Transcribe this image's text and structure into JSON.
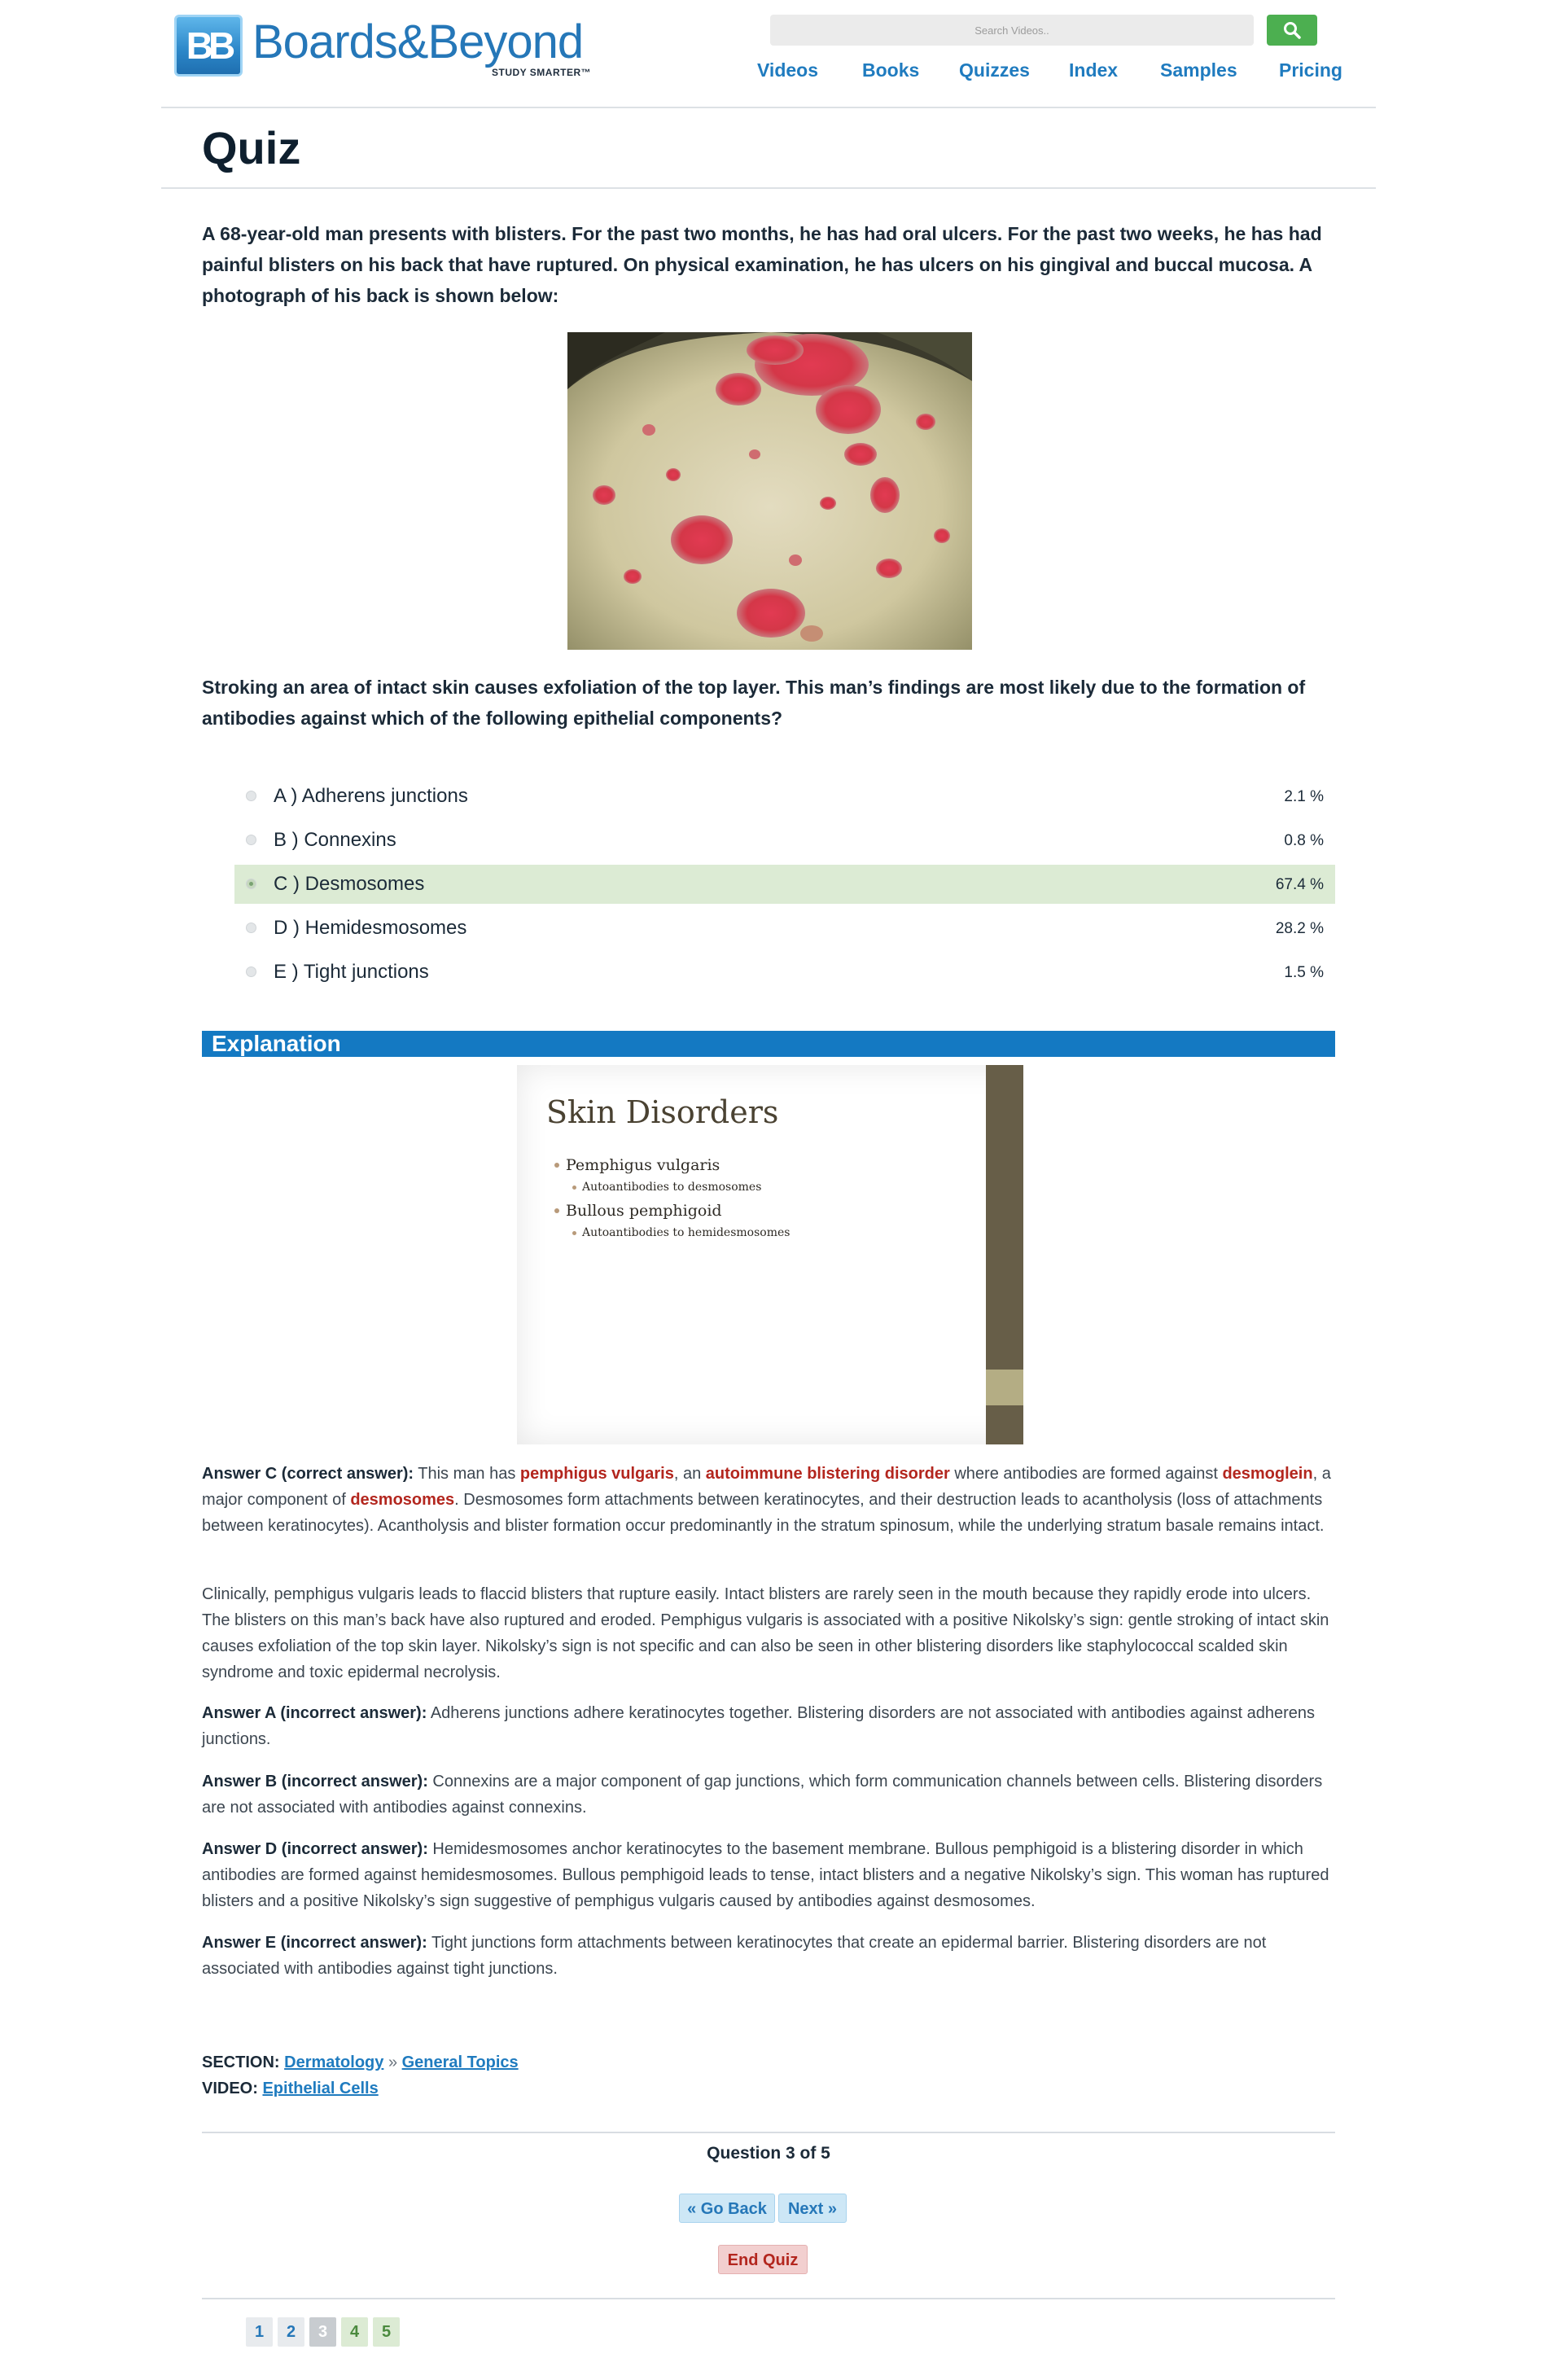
{
  "brand": {
    "logo_badge": "BB",
    "name": "Boards&Beyond",
    "tagline": "STUDY SMARTER™",
    "color": "#2577b8"
  },
  "search": {
    "placeholder": "Search Videos.."
  },
  "nav": [
    "Videos",
    "Books",
    "Quizzes",
    "Index",
    "Samples",
    "Pricing"
  ],
  "page": {
    "title": "Quiz"
  },
  "question": {
    "stem": "A 68-year-old man presents with blisters. For the past two months, he has had oral ulcers. For the past two weeks, he has had painful blisters on his back that have ruptured. On physical examination, he has ulcers on his gingival and buccal mucosa. A photograph of his back is shown below:",
    "prompt": "Stroking an area of intact skin causes exfoliation of the top layer. This man’s findings are most likely due to the formation of antibodies against which of the following epithelial components?"
  },
  "options": [
    {
      "label": "A ) Adherens junctions",
      "pct": "2.1 %"
    },
    {
      "label": "B ) Connexins",
      "pct": "0.8 %"
    },
    {
      "label": "C ) Desmosomes",
      "pct": "67.4 %"
    },
    {
      "label": "D ) Hemidesmosomes",
      "pct": "28.2 %"
    },
    {
      "label": "E ) Tight junctions",
      "pct": "1.5 %"
    }
  ],
  "selected_option": "C",
  "explanation": {
    "heading": "Explanation",
    "slide": {
      "title": "Skin Disorders",
      "b1": "Pemphigus vulgaris",
      "b1_sub": "Autoantibodies to desmosomes",
      "b2": "Bullous pemphigoid",
      "b2_sub": "Autoantibodies to hemidesmosomes"
    },
    "c": {
      "label": "Answer C (correct answer):",
      "t1": " This man has ",
      "h1": "pemphigus vulgaris",
      "t2": ", an ",
      "h2": "autoimmune blistering disorder",
      "t3": " where antibodies are formed against ",
      "h3": "desmoglein",
      "t4": ", a major component of ",
      "h4": "desmosomes",
      "t5": ". Desmosomes form attachments between keratinocytes, and their destruction leads to acantholysis (loss of attachments between keratinocytes). Acantholysis and blister formation occur predominantly in the stratum spinosum, while the underlying stratum basale remains intact."
    },
    "clinical": "Clinically, pemphigus vulgaris leads to flaccid blisters that rupture easily. Intact blisters are rarely seen in the mouth because they rapidly erode into ulcers. The blisters on this man’s back have also ruptured and eroded. Pemphigus vulgaris is associated with a positive Nikolsky’s sign: gentle stroking of intact skin causes exfoliation of the top skin layer. Nikolsky’s sign is not specific and can also be seen in other blistering disorders like staphylococcal scalded skin syndrome and toxic epidermal necrolysis.",
    "a": {
      "label": "Answer A (incorrect answer):",
      "text": " Adherens junctions adhere keratinocytes together. Blistering disorders are not associated with antibodies against adherens junctions."
    },
    "b": {
      "label": "Answer B (incorrect answer):",
      "text": " Connexins are a major component of gap junctions, which form communication channels between cells. Blistering disorders are not associated with antibodies against connexins."
    },
    "d": {
      "label": "Answer D (incorrect answer):",
      "text": " Hemidesmosomes anchor keratinocytes to the basement membrane. Bullous pemphigoid is a blistering disorder in which antibodies are formed against hemidesmosomes. Bullous pemphigoid leads to tense, intact blisters and a negative Nikolsky’s sign. This woman has ruptured blisters and a positive Nikolsky’s sign suggestive of pemphigus vulgaris caused by antibodies against desmosomes."
    },
    "e": {
      "label": "Answer E (incorrect answer):",
      "text": " Tight junctions form attachments between keratinocytes that create an epidermal barrier. Blistering disorders are not associated with antibodies against tight junctions."
    }
  },
  "meta": {
    "section_label": "SECTION:",
    "section": "Dermatology",
    "separator": "»",
    "subsection": "General Topics",
    "video_label": "VIDEO:",
    "video": "Epithelial Cells"
  },
  "progress": {
    "text": "Question 3 of 5",
    "back": "« Go Back",
    "next": "Next »",
    "end": "End Quiz",
    "pages": [
      "1",
      "2",
      "3",
      "4",
      "5"
    ],
    "current": 3
  },
  "colors": {
    "highlight_red": "#b3261e",
    "selected_green": "#dcebd4",
    "explanation_blue": "#1479c2",
    "search_green": "#4caf50"
  }
}
